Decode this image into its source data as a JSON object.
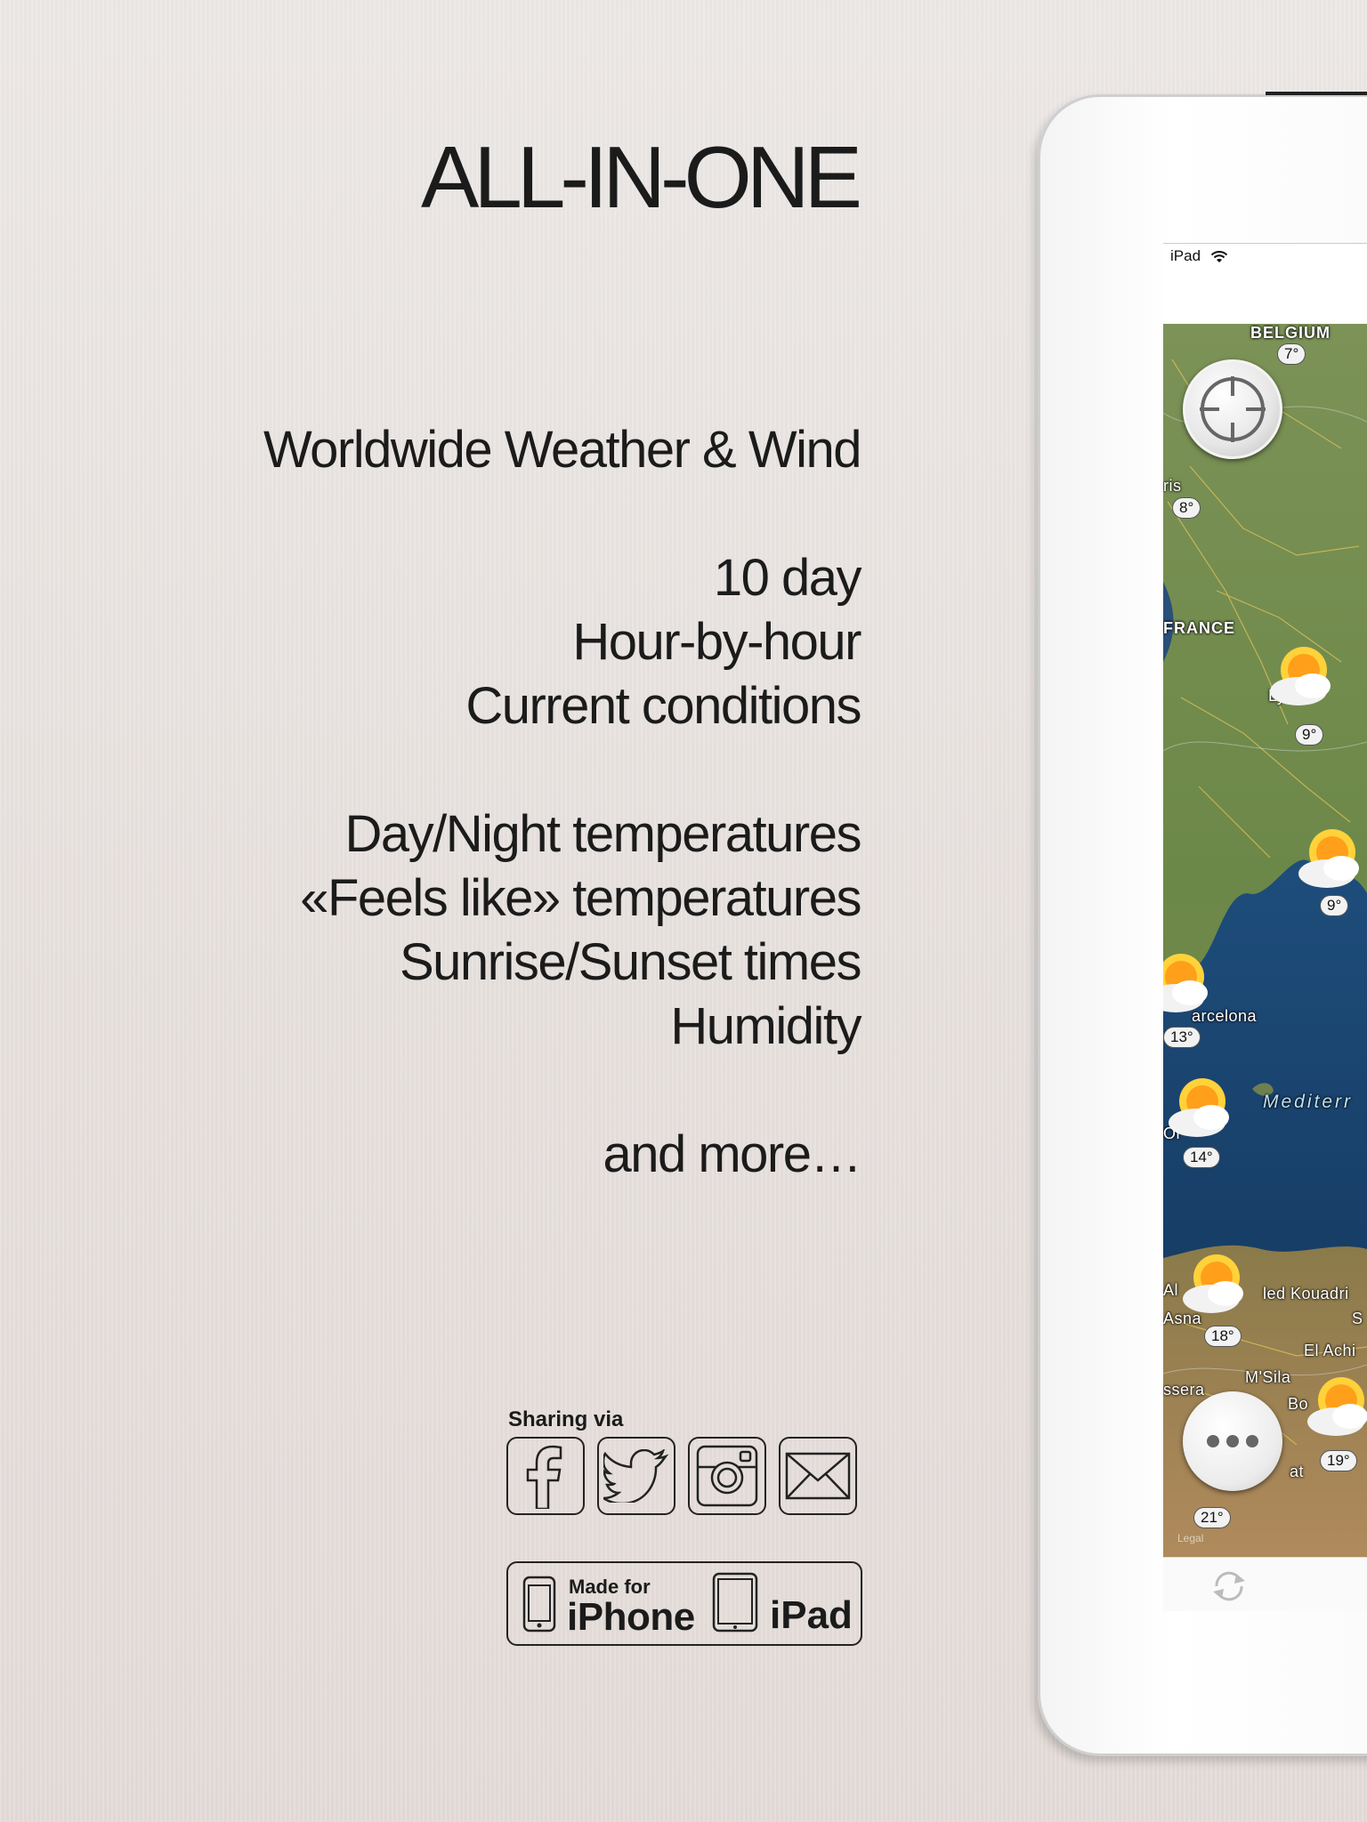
{
  "headline": "ALL-IN-ONE",
  "features": {
    "group1": [
      "Worldwide Weather & Wind"
    ],
    "group2": [
      "10 day",
      "Hour-by-hour",
      "Current conditions"
    ],
    "group3": [
      "Day/Night temperatures",
      "«Feels like» temperatures",
      "Sunrise/Sunset times",
      "Humidity"
    ],
    "group4": [
      "and more…"
    ]
  },
  "sharing": {
    "label": "Sharing via",
    "icons": [
      "facebook-icon",
      "twitter-icon",
      "instagram-icon",
      "mail-icon"
    ]
  },
  "badge": {
    "made_for": "Made for",
    "iphone": "iPhone",
    "ipad": "iPad"
  },
  "device": {
    "status_bar": {
      "carrier": "iPad",
      "icon": "wifi-icon"
    },
    "map": {
      "country_labels": [
        "BELGIUM",
        "FRANCE"
      ],
      "sea_label": "Mediterr",
      "place_labels": [
        "ris",
        "Ly",
        "arcelona",
        "Or",
        "Al",
        "led Kouadri",
        "Asna",
        "S",
        "El Achi",
        "M'Sila",
        "ssera",
        "Bo",
        "at"
      ],
      "temperatures": [
        "7°",
        "8°",
        "9°",
        "9°",
        "13°",
        "14°",
        "18°",
        "19°",
        "21°"
      ],
      "legal": "Legal",
      "weather_icon": "partly-sunny-icon"
    },
    "controls": {
      "locate": "crosshair-icon",
      "more": "more-dots-icon",
      "refresh": "refresh-icon"
    }
  },
  "colors": {
    "background": "#e8e3e0",
    "text": "#1b1b1b",
    "sea": "#1c4a78",
    "land": "#6f8a4a"
  }
}
